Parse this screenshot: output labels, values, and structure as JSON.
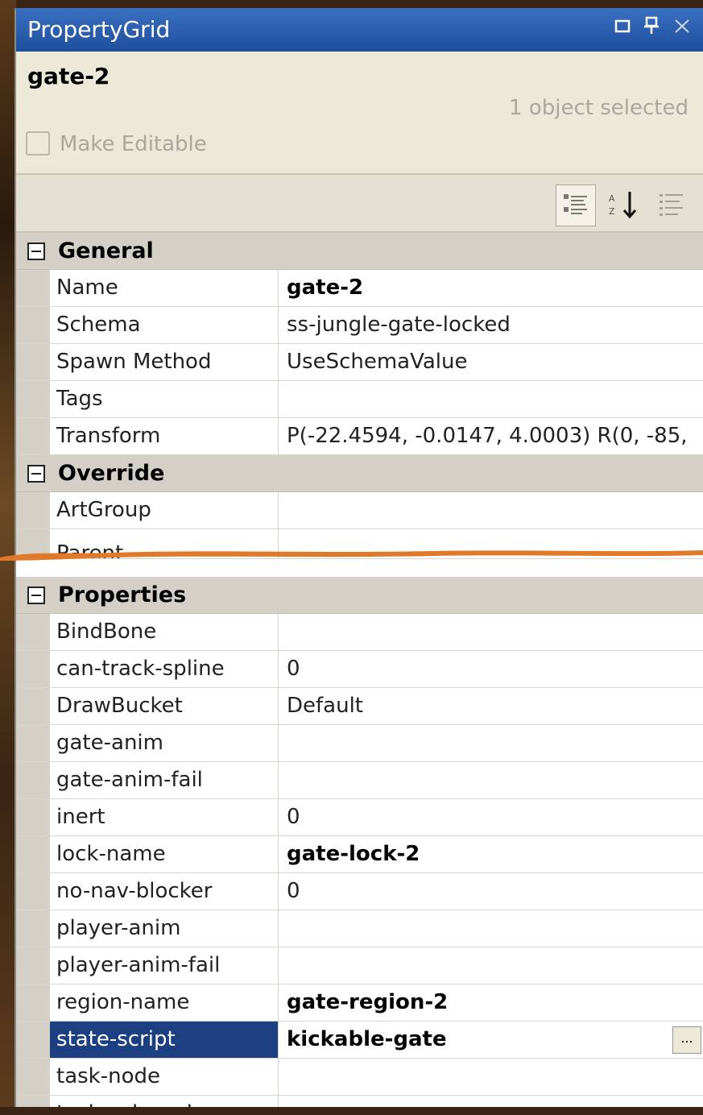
{
  "window": {
    "title": "PropertyGrid",
    "buttons": [
      "□",
      "⊓",
      "✕"
    ]
  },
  "header": {
    "object_name": "gate-2",
    "selection_count": "1 object selected",
    "make_editable_label": "Make Editable"
  },
  "toolbar": {
    "categorized": "categorized-icon",
    "alphabetical": "sort-az-icon",
    "property_pages": "property-pages-icon"
  },
  "categories": {
    "general": "General",
    "override": "Override",
    "properties": "Properties"
  },
  "general_rows": [
    {
      "name": "Name",
      "value": "gate-2"
    },
    {
      "name": "Schema",
      "value": "ss-jungle-gate-locked"
    },
    {
      "name": "Spawn Method",
      "value": "UseSchemaValue"
    },
    {
      "name": "Tags",
      "value": ""
    },
    {
      "name": "Transform",
      "value": "P(-22.4594, -0.0147, 4.0003) R(0, -85,"
    }
  ],
  "override_rows": [
    {
      "name": "ArtGroup",
      "value": ""
    },
    {
      "name": "Parent",
      "value": ""
    }
  ],
  "property_rows": [
    {
      "name": "BindBone",
      "value": ""
    },
    {
      "name": "can-track-spline",
      "value": "0"
    },
    {
      "name": "DrawBucket",
      "value": "Default"
    },
    {
      "name": "gate-anim",
      "value": ""
    },
    {
      "name": "gate-anim-fail",
      "value": ""
    },
    {
      "name": "inert",
      "value": "0"
    },
    {
      "name": "lock-name",
      "value": "gate-lock-2"
    },
    {
      "name": "no-nav-blocker",
      "value": "0"
    },
    {
      "name": "player-anim",
      "value": ""
    },
    {
      "name": "player-anim-fail",
      "value": ""
    },
    {
      "name": "region-name",
      "value": "gate-region-2"
    },
    {
      "name": "state-script",
      "value": "kickable-gate"
    },
    {
      "name": "task-node",
      "value": ""
    },
    {
      "name": "task-sub-node",
      "value": ""
    }
  ],
  "ellipsis_label": "...",
  "colors": {
    "titlebar": "#1f4f9c",
    "selected_row": "#1c3f82",
    "torn_line": "#e07a2a"
  }
}
